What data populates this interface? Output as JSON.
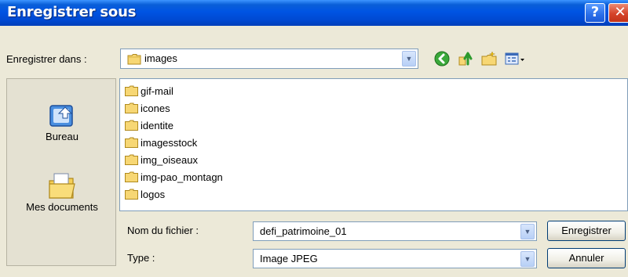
{
  "window": {
    "title": "Enregistrer sous",
    "help_label": "?",
    "close_label": "✕"
  },
  "savein": {
    "label": "Enregistrer dans :",
    "value": "images",
    "arrow": "▼"
  },
  "toolbar": {
    "icons": [
      "back-icon",
      "up-folder-icon",
      "new-folder-icon",
      "view-menu-icon"
    ]
  },
  "places": [
    {
      "label": "Bureau",
      "icon": "desktop-icon"
    },
    {
      "label": "Mes documents",
      "icon": "my-documents-icon"
    }
  ],
  "folders": [
    "gif-mail",
    "icones",
    "identite",
    "imagesstock",
    "img_oiseaux",
    "img-pao_montagn",
    "logos"
  ],
  "filename": {
    "label": "Nom du fichier :",
    "value": "defi_patrimoine_01",
    "arrow": "▼"
  },
  "filetype": {
    "label": "Type :",
    "value": "Image JPEG",
    "arrow": "▼"
  },
  "buttons": {
    "save": "Enregistrer",
    "cancel": "Annuler"
  },
  "colors": {
    "titlebar": "#0054e3",
    "face": "#ece9d8",
    "close": "#d5442a"
  }
}
